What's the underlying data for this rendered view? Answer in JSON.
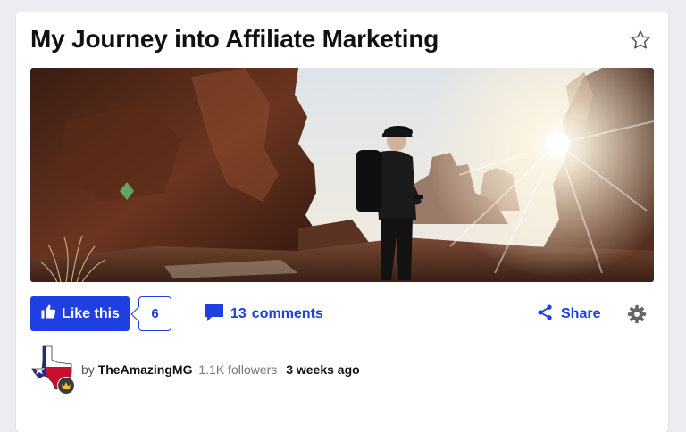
{
  "article": {
    "title": "My Journey into Affiliate Marketing"
  },
  "hero_image": {
    "description": "hiker-with-backpack-checking-phone-among-red-rock-formations-at-sunrise"
  },
  "actions": {
    "like_label": "Like this",
    "like_count": "6",
    "comments_count": "13",
    "comments_label": "comments",
    "share_label": "Share"
  },
  "author": {
    "by": "by",
    "name": "TheAmazingMG",
    "followers": "1.1K followers",
    "posted": "3 weeks ago"
  },
  "icons": {
    "favorite": "star-outline-icon",
    "like": "thumbs-up-icon",
    "comments": "speech-bubble-icon",
    "share": "share-icon",
    "settings": "gear-icon",
    "badge": "crown-icon"
  },
  "colors": {
    "accent": "#1f3fe0",
    "background": "#ecedf1",
    "card": "#ffffff",
    "title_text": "#111111"
  }
}
